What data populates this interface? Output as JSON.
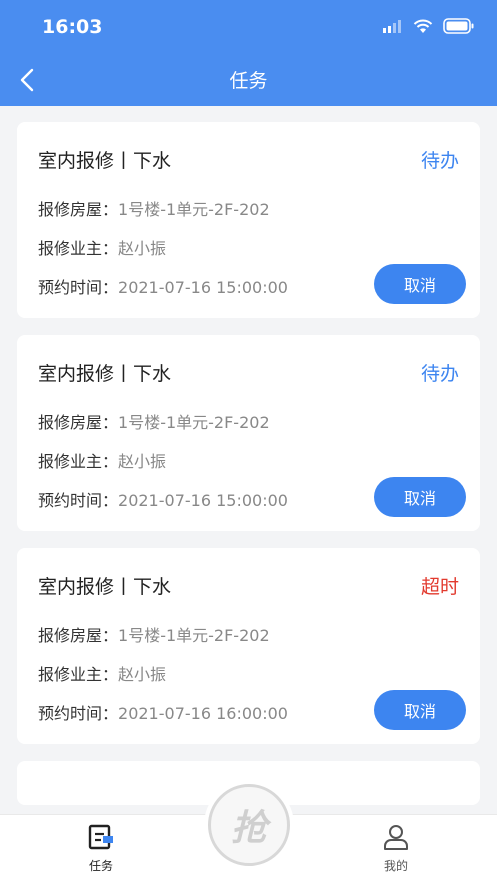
{
  "status_bar": {
    "time": "16:03"
  },
  "nav": {
    "title": "任务"
  },
  "colors": {
    "primary": "#4a8df0",
    "pending": "#3d85f0",
    "overdue": "#e23a2e"
  },
  "labels": {
    "house": "报修房屋：",
    "owner": "报修业主：",
    "appointment": "预约时间："
  },
  "tasks": [
    {
      "title": "室内报修丨下水",
      "status": "待办",
      "status_color": "#3d85f0",
      "house": "1号楼-1单元-2F-202",
      "owner": "赵小振",
      "time": "2021-07-16 15:00:00",
      "cancel_label": "取消"
    },
    {
      "title": "室内报修丨下水",
      "status": "待办",
      "status_color": "#3d85f0",
      "house": "1号楼-1单元-2F-202",
      "owner": "赵小振",
      "time": "2021-07-16 15:00:00",
      "cancel_label": "取消"
    },
    {
      "title": "室内报修丨下水",
      "status": "超时",
      "status_color": "#e23a2e",
      "house": "1号楼-1单元-2F-202",
      "owner": "赵小振",
      "time": "2021-07-16 16:00:00",
      "cancel_label": "取消"
    }
  ],
  "tabbar": {
    "tasks_label": "任务",
    "grab_label": "抢",
    "mine_label": "我的"
  }
}
